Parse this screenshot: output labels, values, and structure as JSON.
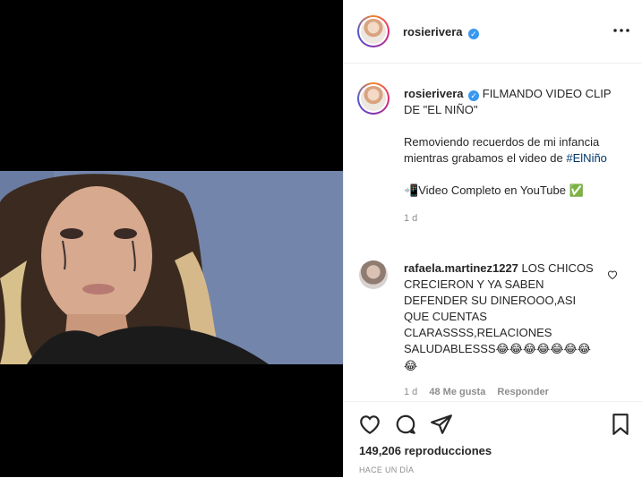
{
  "post": {
    "username": "rosierivera",
    "verified_mark": "✓",
    "more_options_icon": "more-horizontal-icon"
  },
  "caption": {
    "username": "rosierivera",
    "title": "FILMANDO VIDEO CLIP DE \"EL NIÑO\"",
    "line1": "Removiendo recuerdos de mi infancia mientras grabamos el video de",
    "hashtag": "#ElNiño",
    "youtube_emoji": "📲",
    "youtube_text": "Video Completo en YouTube",
    "check_emoji": "✅",
    "time": "1 d"
  },
  "comment": {
    "username": "rafaela.martinez1227",
    "text": "LOS CHICOS CRECIERON Y YA SABEN DEFENDER SU DINEROOO,ASI QUE CUENTAS CLARASSSS,RELACIONES SALUDABLESSS",
    "emojis": "😂😂😂😂😂😂😂😂",
    "time": "1 d",
    "likes": "48 Me gusta",
    "reply": "Responder"
  },
  "stats": {
    "views": "149,206 reproducciones",
    "ago": "HACE UN DÍA"
  },
  "colors": {
    "verified": "#3897f0",
    "link": "#00376b",
    "muted": "#8e8e8e"
  }
}
